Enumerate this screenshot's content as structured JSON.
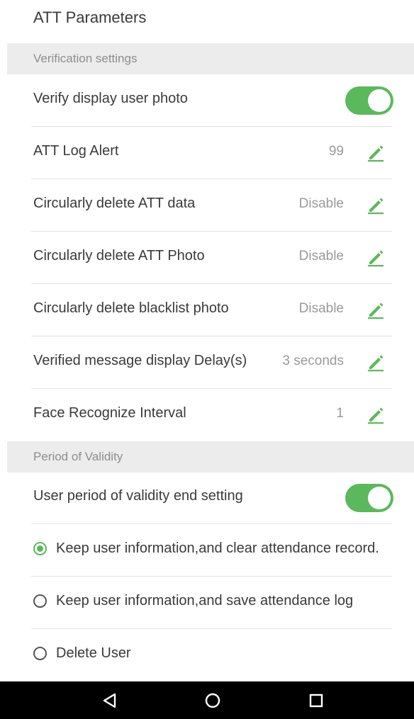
{
  "header": {
    "title": "ATT Parameters"
  },
  "sections": {
    "verification": "Verification settings",
    "validity": "Period of Validity"
  },
  "rows": {
    "verify_photo": {
      "label": "Verify display user photo",
      "toggle_on": true
    },
    "log_alert": {
      "label": "ATT Log Alert",
      "value": "99"
    },
    "delete_att_data": {
      "label": "Circularly delete ATT data",
      "value": "Disable"
    },
    "delete_att_photo": {
      "label": "Circularly delete ATT Photo",
      "value": "Disable"
    },
    "delete_blacklist": {
      "label": "Circularly delete blacklist photo",
      "value": "Disable"
    },
    "message_delay": {
      "label": "Verified message display Delay(s)",
      "value": "3 seconds"
    },
    "face_interval": {
      "label": "Face Recognize Interval",
      "value": "1"
    },
    "validity_end": {
      "label": "User period of validity end setting",
      "toggle_on": true
    }
  },
  "radio_options": [
    {
      "label": "Keep user information,and clear attendance record.",
      "selected": true
    },
    {
      "label": "Keep user information,and save attendance log",
      "selected": false
    },
    {
      "label": "Delete User",
      "selected": false
    }
  ],
  "icons": {
    "edit": "edit-pencil-icon",
    "back": "back-triangle-icon",
    "home": "home-circle-icon",
    "recents": "recents-square-icon"
  },
  "colors": {
    "accent": "#5cb85c",
    "section_bg": "#ececec",
    "nav_bg": "#000000"
  }
}
